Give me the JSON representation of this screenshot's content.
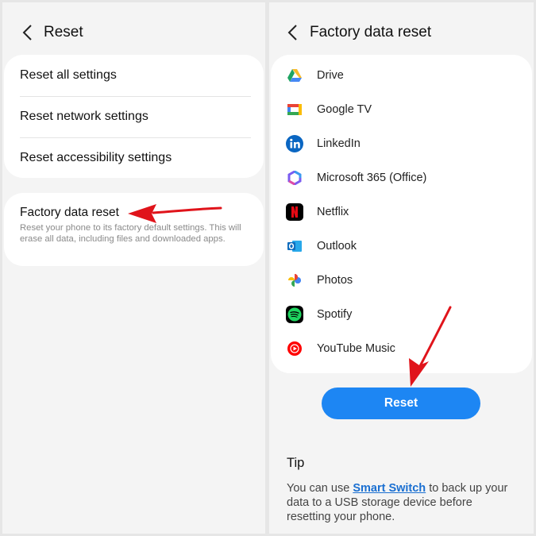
{
  "left": {
    "title": "Reset",
    "menu": [
      "Reset all settings",
      "Reset network settings",
      "Reset accessibility settings"
    ],
    "factory_reset": {
      "title": "Factory data reset",
      "description": "Reset your phone to its factory default settings. This will erase all data, including files and downloaded apps."
    }
  },
  "right": {
    "title": "Factory data reset",
    "apps": [
      {
        "label": "Drive",
        "icon": "google-drive-icon"
      },
      {
        "label": "Google TV",
        "icon": "google-tv-icon"
      },
      {
        "label": "LinkedIn",
        "icon": "linkedin-icon"
      },
      {
        "label": "Microsoft 365 (Office)",
        "icon": "microsoft-365-icon"
      },
      {
        "label": "Netflix",
        "icon": "netflix-icon"
      },
      {
        "label": "Outlook",
        "icon": "outlook-icon"
      },
      {
        "label": "Photos",
        "icon": "google-photos-icon"
      },
      {
        "label": "Spotify",
        "icon": "spotify-icon"
      },
      {
        "label": "YouTube Music",
        "icon": "youtube-music-icon"
      }
    ],
    "reset_button": "Reset",
    "tip": {
      "title": "Tip",
      "text_before": "You can use ",
      "link": "Smart Switch",
      "text_after": " to back up your data to a USB storage device before resetting your phone."
    }
  },
  "colors": {
    "accent": "#1d86f3",
    "annotation_arrow": "#e0141b",
    "link": "#1a6fd1"
  }
}
